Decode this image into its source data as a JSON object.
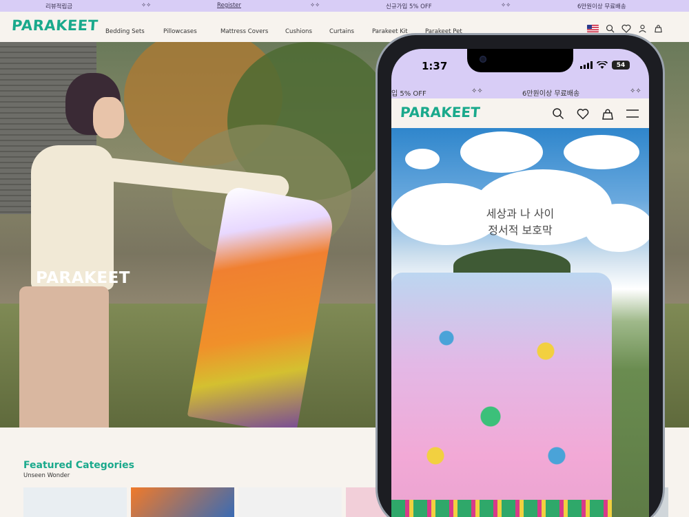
{
  "announce": {
    "items": [
      "리뷰적립금",
      "Register",
      "신규가입 5% OFF",
      "6만원이상 무료배송"
    ],
    "separator": "✧✧"
  },
  "header": {
    "logo": "PARAKEET",
    "nav": [
      "Bedding Sets",
      "Pillowcases",
      "Mattress Covers",
      "Cushions",
      "Curtains",
      "Parakeet Kit",
      "Parakeet Pet"
    ]
  },
  "hero": {
    "logo": "PARAKEET"
  },
  "featured": {
    "title": "Featured Categories",
    "subtitle": "Unseen Wonder"
  },
  "phone": {
    "time": "1:37",
    "battery": "54",
    "announce": [
      "입 5% OFF",
      "6만원이상 무료배송"
    ],
    "separator": "✧✧",
    "logo": "PARAKEET",
    "headline": [
      "세상과 나 사이",
      "정서적 보호막"
    ]
  },
  "colors": {
    "brand": "#1aa98c",
    "announce_bg": "#d8cdf6",
    "page_bg": "#f7f3ee"
  }
}
